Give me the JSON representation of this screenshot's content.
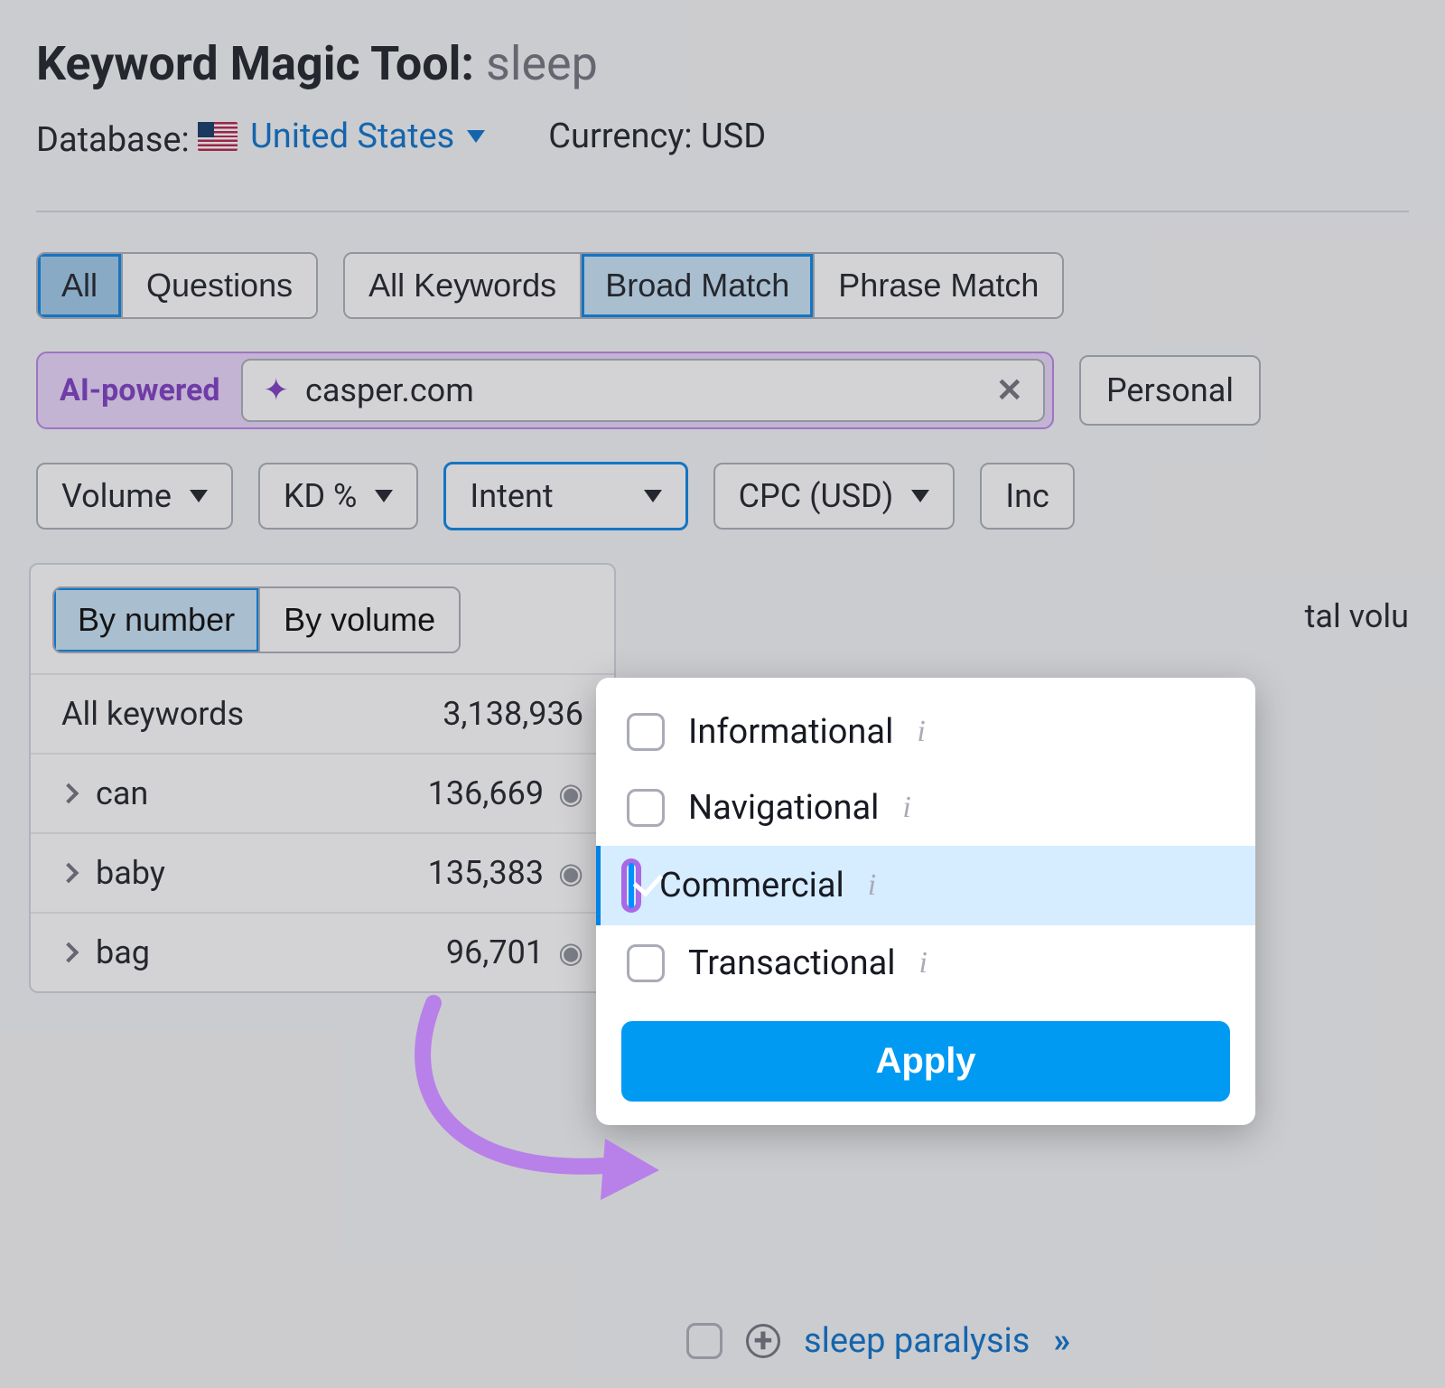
{
  "header": {
    "title_prefix": "Keyword Magic Tool:",
    "title_keyword": "sleep",
    "database_label": "Database:",
    "database_value": "United States",
    "currency_label": "Currency:",
    "currency_value": "USD"
  },
  "match_tabs": {
    "group1": [
      "All",
      "Questions"
    ],
    "group1_active": 0,
    "group2": [
      "All Keywords",
      "Broad Match",
      "Phrase Match"
    ],
    "group2_active": 1
  },
  "ai_row": {
    "badge": "AI-powered",
    "domain_value": "casper.com",
    "right_truncated": "Personal"
  },
  "filters": {
    "volume": "Volume",
    "kd": "KD %",
    "intent": "Intent",
    "cpc": "CPC (USD)",
    "inc_truncated": "Inc"
  },
  "intent_dropdown": {
    "options": [
      {
        "label": "Informational",
        "checked": false
      },
      {
        "label": "Navigational",
        "checked": false
      },
      {
        "label": "Commercial",
        "checked": true
      },
      {
        "label": "Transactional",
        "checked": false
      }
    ],
    "apply": "Apply"
  },
  "left_panel": {
    "sort_tabs": [
      "By number",
      "By volume"
    ],
    "sort_active": 0,
    "header_label": "All keywords",
    "header_count": "3,138,936",
    "rows": [
      {
        "kw": "can",
        "count": "136,669"
      },
      {
        "kw": "baby",
        "count": "135,383"
      },
      {
        "kw": "bag",
        "count": "96,701"
      }
    ]
  },
  "right_truncated_text": "tal volu",
  "bottom_fragment": {
    "keyword": "sleep paralysis"
  }
}
